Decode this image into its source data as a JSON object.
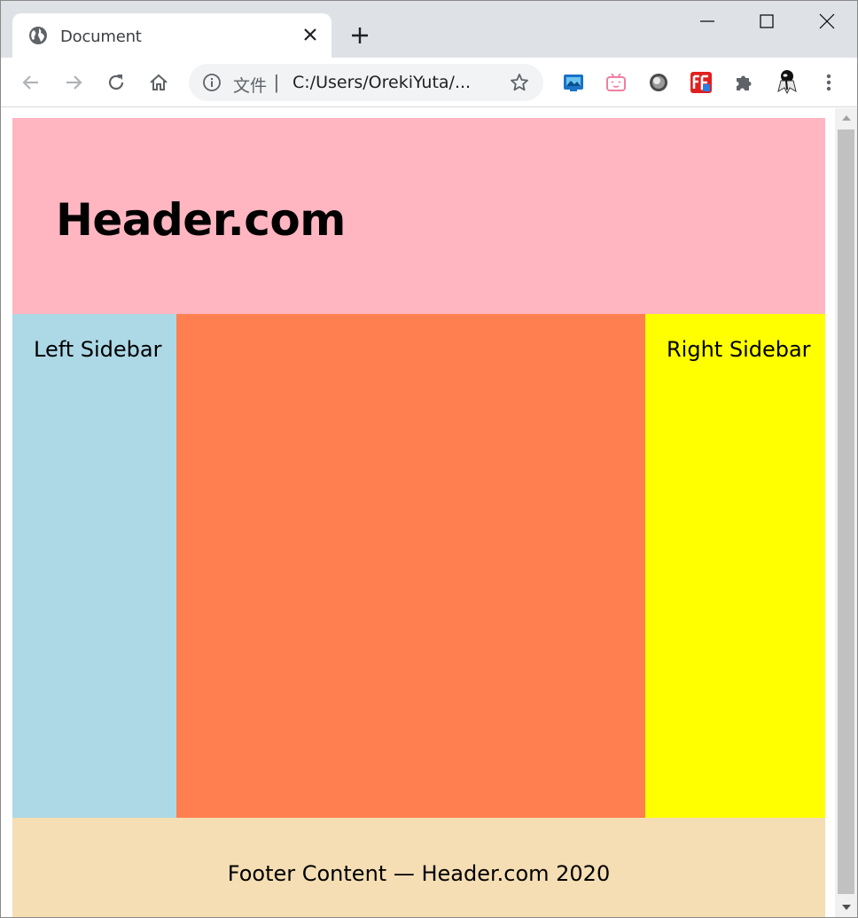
{
  "browser": {
    "tab": {
      "title": "Document"
    },
    "omnibox": {
      "scheme_label": "文件",
      "separator": "|",
      "url": "C:/Users/OrekiYuta/..."
    }
  },
  "colors": {
    "header_bg": "#ffb6c1",
    "left_sidebar_bg": "#add8e6",
    "main_bg": "#ff7f50",
    "right_sidebar_bg": "#ffff00",
    "footer_bg": "#f5deb3"
  },
  "page": {
    "header": {
      "title": "Header.com"
    },
    "left_sidebar": {
      "label": "Left Sidebar"
    },
    "right_sidebar": {
      "label": "Right Sidebar"
    },
    "footer": {
      "text": "Footer Content — Header.com 2020"
    }
  },
  "icons": {
    "tab_favicon": "globe-icon",
    "extensions": [
      "screen-capture-icon",
      "bilibili-tv-icon",
      "sphere-icon",
      "fe-helper-icon",
      "puzzle-icon",
      "avatar-icon"
    ]
  }
}
